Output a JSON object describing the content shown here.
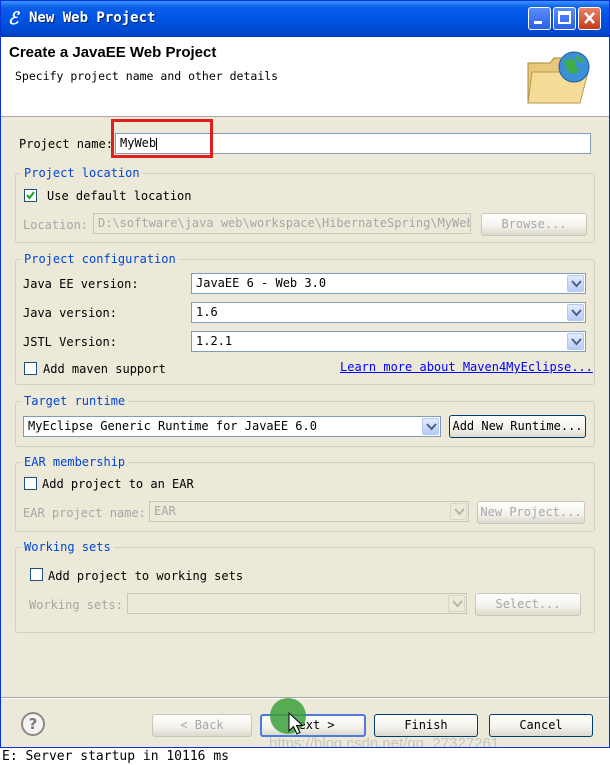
{
  "window": {
    "title": "New Web Project"
  },
  "header": {
    "title": "Create a JavaEE Web Project",
    "description": "Specify project name and other details"
  },
  "project_name": {
    "label": "Project name:",
    "value": "MyWeb"
  },
  "project_location": {
    "legend": "Project location",
    "use_default_label": "Use default location",
    "use_default_checked": true,
    "location_label": "Location:",
    "location_value": "D:\\software\\java web\\workspace\\HibernateSpring\\MyWeb",
    "browse_label": "Browse..."
  },
  "project_configuration": {
    "legend": "Project configuration",
    "javaee_label": "Java EE version:",
    "javaee_value": "JavaEE 6 - Web 3.0",
    "java_label": "Java version:",
    "java_value": "1.6",
    "jstl_label": "JSTL Version:",
    "jstl_value": "1.2.1",
    "maven_label": "Add maven support",
    "maven_checked": false,
    "learn_more_link": "Learn more about Maven4MyEclipse..."
  },
  "target_runtime": {
    "legend": "Target runtime",
    "value": "MyEclipse Generic Runtime for JavaEE 6.0",
    "add_runtime_label": "Add New Runtime..."
  },
  "ear_membership": {
    "legend": "EAR membership",
    "add_label": "Add project to an EAR",
    "add_checked": false,
    "name_label": "EAR project name:",
    "name_value": "EAR",
    "new_project_label": "New Project..."
  },
  "working_sets": {
    "legend": "Working sets",
    "add_label": "Add project to working sets",
    "add_checked": false,
    "sets_label": "Working sets:",
    "sets_value": "",
    "select_label": "Select..."
  },
  "footer": {
    "help_glyph": "?",
    "back_label": "< Back",
    "next_label": "Next >",
    "finish_label": "Finish",
    "cancel_label": "Cancel"
  },
  "overlay": {
    "watermark": "https://blog.csdn.net/qq_27327261",
    "console_text": "E: Server startup in 10116 ms"
  },
  "colors": {
    "titlebar": "#0054e3",
    "dialog_bg": "#ece9d8",
    "legend_blue": "#0046d5",
    "highlight_red": "#e02020",
    "link_blue": "#0000ff"
  }
}
